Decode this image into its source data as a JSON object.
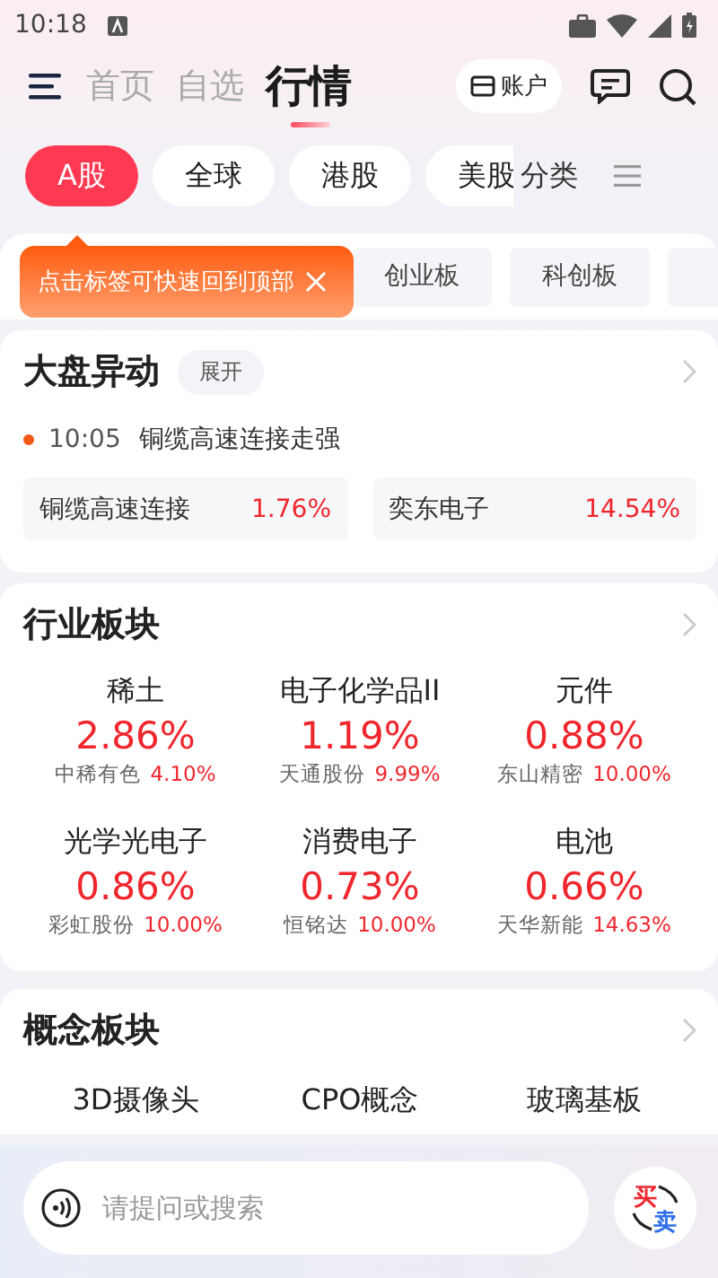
{
  "status_bar": {
    "time": "10:18"
  },
  "nav_tabs": [
    {
      "label": "首页",
      "selected": false
    },
    {
      "label": "自选",
      "selected": false
    },
    {
      "label": "行情",
      "selected": true
    }
  ],
  "account_button": {
    "label": "账户"
  },
  "market_tabs": [
    {
      "label": "A股",
      "selected": true
    },
    {
      "label": "全球",
      "selected": false
    },
    {
      "label": "港股",
      "selected": false
    },
    {
      "label": "美股",
      "selected": false
    }
  ],
  "category_link": {
    "label": "分类"
  },
  "sub_tabs": [
    {
      "label": "创业板"
    },
    {
      "label": "科创板"
    }
  ],
  "tooltip": {
    "text": "点击标签可快速回到顶部"
  },
  "market_moves": {
    "title": "大盘异动",
    "expand_label": "展开",
    "event_time": "10:05",
    "event_text": "铜缆高速连接走强",
    "items": [
      {
        "name": "铜缆高速连接",
        "change": "1.76%"
      },
      {
        "name": "奕东电子",
        "change": "14.54%"
      }
    ]
  },
  "industry": {
    "title": "行业板块",
    "items": [
      {
        "name": "稀土",
        "change": "2.86%",
        "leader": "中稀有色",
        "leader_change": "4.10%"
      },
      {
        "name": "电子化学品II",
        "change": "1.19%",
        "leader": "天通股份",
        "leader_change": "9.99%"
      },
      {
        "name": "元件",
        "change": "0.88%",
        "leader": "东山精密",
        "leader_change": "10.00%"
      },
      {
        "name": "光学光电子",
        "change": "0.86%",
        "leader": "彩虹股份",
        "leader_change": "10.00%"
      },
      {
        "name": "消费电子",
        "change": "0.73%",
        "leader": "恒铭达",
        "leader_change": "10.00%"
      },
      {
        "name": "电池",
        "change": "0.66%",
        "leader": "天华新能",
        "leader_change": "14.63%"
      }
    ]
  },
  "concept": {
    "title": "概念板块",
    "items": [
      {
        "name": "3D摄像头"
      },
      {
        "name": "CPO概念"
      },
      {
        "name": "玻璃基板"
      }
    ]
  },
  "search": {
    "placeholder": "请提问或搜索"
  },
  "trade_button": {
    "buy": "买",
    "sell": "卖"
  }
}
